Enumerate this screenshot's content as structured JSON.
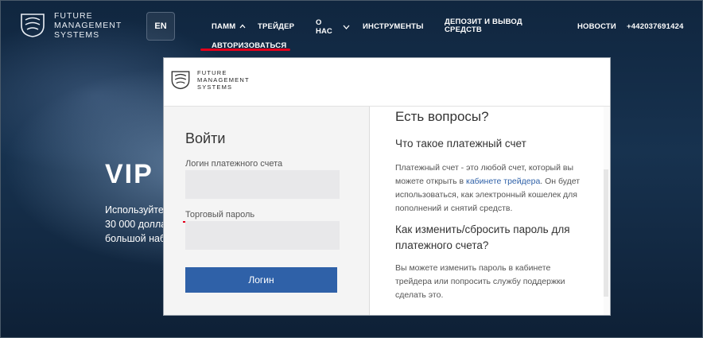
{
  "header": {
    "logo_lines": [
      "FUTURE",
      "MANAGEMENT",
      "SYSTEMS"
    ],
    "lang": "EN",
    "nav": {
      "pamm": "ПАММ",
      "trader": "ТРЕЙДЕР",
      "about_1": "О",
      "about_2": "НАС",
      "tools": "ИНСТРУМЕНТЫ",
      "deposit_1": "ДЕПОЗИТ И ВЫВОД",
      "deposit_2": "СРЕДСТВ",
      "news": "НОВОСТИ",
      "phone": "+442037691424",
      "authorize": "АВТОРИЗОВАТЬСЯ"
    }
  },
  "hero": {
    "title": "VIP",
    "line1": "Используйте",
    "line2": "30 000 долла",
    "line3": "большой наб"
  },
  "popup": {
    "logo_lines": [
      "FUTURE",
      "MANAGEMENT",
      "SYSTEMS"
    ],
    "login": {
      "title": "Войти",
      "account_label": "Логин платежного счета",
      "account_value": "",
      "password_label": "Торговый пароль",
      "password_value": "",
      "button": "Логин"
    },
    "faq": {
      "title": "Есть вопросы?",
      "q1": "Что такое платежный счет",
      "a1_part1": "Платежный счет - это любой счет, который вы",
      "a1_part2": "можете открыть в ",
      "a1_link": "кабинете трейдера",
      "a1_part3": ". Он будет",
      "a1_part4": "использоваться, как электронный кошелек для",
      "a1_part5": "пополнений и снятий средств.",
      "q2_line1": "Как изменить/сбросить пароль для",
      "q2_line2": "платежного счета?",
      "a2_line1": "Вы можете изменить пароль в кабинете",
      "a2_line2": "трейдера или попросить службу поддержки",
      "a2_line3": "сделать это."
    }
  },
  "colors": {
    "accent_red": "#e3001b",
    "button_blue": "#2f61a8",
    "header_bg": "#10263f"
  }
}
